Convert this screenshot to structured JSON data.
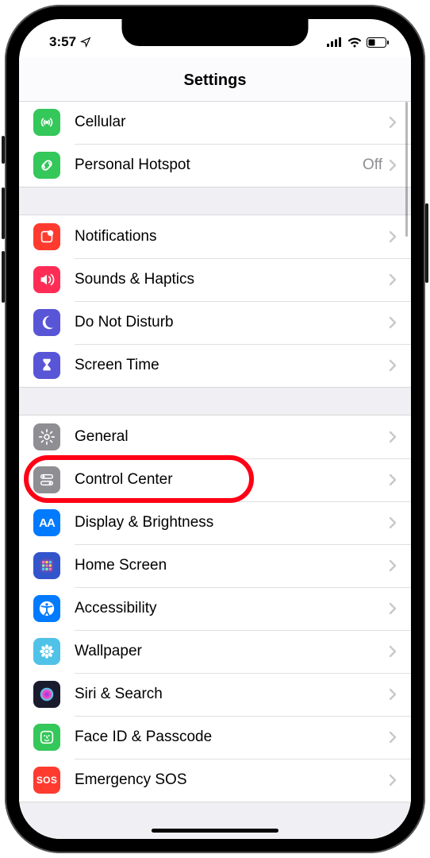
{
  "status": {
    "time": "3:57",
    "location_icon": "location-arrow",
    "cellular": 4,
    "wifi": 3,
    "battery": 35
  },
  "header": {
    "title": "Settings"
  },
  "sections": [
    {
      "rows": [
        {
          "key": "cellular",
          "label": "Cellular",
          "detail": "",
          "icon": "antenna",
          "bg": "#34c759"
        },
        {
          "key": "hotspot",
          "label": "Personal Hotspot",
          "detail": "Off",
          "icon": "link",
          "bg": "#34c759"
        }
      ]
    },
    {
      "rows": [
        {
          "key": "notifications",
          "label": "Notifications",
          "detail": "",
          "icon": "notifications",
          "bg": "#ff3b30"
        },
        {
          "key": "sounds",
          "label": "Sounds & Haptics",
          "detail": "",
          "icon": "speaker",
          "bg": "#ff2d55"
        },
        {
          "key": "dnd",
          "label": "Do Not Disturb",
          "detail": "",
          "icon": "moon",
          "bg": "#5856d6"
        },
        {
          "key": "screentime",
          "label": "Screen Time",
          "detail": "",
          "icon": "hourglass",
          "bg": "#5856d6"
        }
      ]
    },
    {
      "rows": [
        {
          "key": "general",
          "label": "General",
          "detail": "",
          "icon": "gear",
          "bg": "#8e8e93"
        },
        {
          "key": "controlcenter",
          "label": "Control Center",
          "detail": "",
          "icon": "switches",
          "bg": "#8e8e93",
          "highlighted": true
        },
        {
          "key": "display",
          "label": "Display & Brightness",
          "detail": "",
          "icon": "aa",
          "bg": "#007aff"
        },
        {
          "key": "homescreen",
          "label": "Home Screen",
          "detail": "",
          "icon": "grid",
          "bg": "#3355cc"
        },
        {
          "key": "accessibility",
          "label": "Accessibility",
          "detail": "",
          "icon": "accessibility",
          "bg": "#007aff"
        },
        {
          "key": "wallpaper",
          "label": "Wallpaper",
          "detail": "",
          "icon": "flower",
          "bg": "#50c2e8"
        },
        {
          "key": "siri",
          "label": "Siri & Search",
          "detail": "",
          "icon": "siri",
          "bg": "#1b1b2e"
        },
        {
          "key": "faceid",
          "label": "Face ID & Passcode",
          "detail": "",
          "icon": "face",
          "bg": "#34c759"
        },
        {
          "key": "sos",
          "label": "Emergency SOS",
          "detail": "",
          "icon": "sos",
          "bg": "#ff3b30"
        }
      ]
    }
  ],
  "highlight_color": "#ff0015"
}
